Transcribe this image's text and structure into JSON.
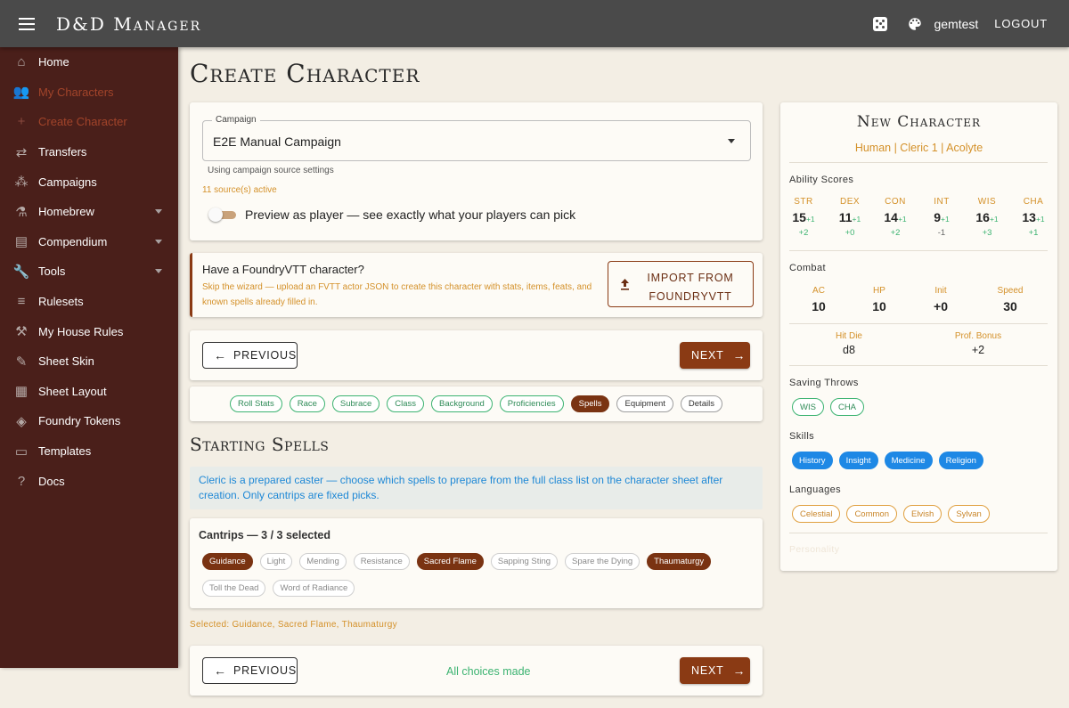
{
  "app": {
    "title": "D&D Manager",
    "username": "gemtest",
    "logout_label": "LOGOUT"
  },
  "sidebar": {
    "items": [
      {
        "label": "Home",
        "icon": "home-icon"
      },
      {
        "label": "My Characters",
        "icon": "people-icon"
      },
      {
        "label": "Create Character",
        "icon": "plus-icon"
      },
      {
        "label": "Transfers",
        "icon": "swap-icon"
      },
      {
        "label": "Campaigns",
        "icon": "groups-icon"
      },
      {
        "label": "Homebrew",
        "icon": "flask-icon"
      },
      {
        "label": "Compendium",
        "icon": "book-icon"
      },
      {
        "label": "Tools",
        "icon": "wrench-icon"
      },
      {
        "label": "Rulesets",
        "icon": "rules-icon"
      },
      {
        "label": "My House Rules",
        "icon": "gavel-icon"
      },
      {
        "label": "Sheet Skin",
        "icon": "brush-icon"
      },
      {
        "label": "Sheet Layout",
        "icon": "layout-icon"
      },
      {
        "label": "Foundry Tokens",
        "icon": "cube-icon"
      },
      {
        "label": "Templates",
        "icon": "document-icon"
      },
      {
        "label": "Docs",
        "icon": "help-icon"
      }
    ]
  },
  "page": {
    "title": "Create Character"
  },
  "campaign": {
    "label": "Campaign",
    "value": "E2E Manual Campaign",
    "help": "Using campaign source settings",
    "sources": "11 source(s) active",
    "toggle_label": "Preview as player — see exactly what your players can pick"
  },
  "foundry": {
    "title": "Have a FoundryVTT character?",
    "description": "Skip the wizard — upload an FVTT actor JSON to create this character with stats, items, feats, and known spells already filled in.",
    "import_label": "IMPORT FROM FOUNDRYVTT"
  },
  "nav": {
    "previous_label": "PREVIOUS",
    "next_label": "NEXT",
    "status": "All choices made"
  },
  "steps": {
    "done": [
      "Roll Stats",
      "Race",
      "Subrace",
      "Class",
      "Background",
      "Proficiencies"
    ],
    "active": "Spells",
    "todo": [
      "Equipment",
      "Details"
    ]
  },
  "spells": {
    "section_title": "Starting Spells",
    "info": "Cleric is a prepared caster — choose which spells to prepare from the full class list on the character sheet after creation. Only cantrips are fixed picks.",
    "cantrip_heading": "Cantrips — 3 / 3 selected",
    "row1": [
      {
        "name": "Guidance",
        "selected": true
      },
      {
        "name": "Light",
        "selected": false
      },
      {
        "name": "Mending",
        "selected": false
      },
      {
        "name": "Resistance",
        "selected": false
      },
      {
        "name": "Sacred Flame",
        "selected": true
      },
      {
        "name": "Sapping Sting",
        "selected": false
      },
      {
        "name": "Spare the Dying",
        "selected": false
      },
      {
        "name": "Thaumaturgy",
        "selected": true
      }
    ],
    "row2": [
      {
        "name": "Toll the Dead",
        "selected": false
      },
      {
        "name": "Word of Radiance",
        "selected": false
      }
    ],
    "selected_summary": "Selected: Guidance, Sacred Flame, Thaumaturgy"
  },
  "summary": {
    "name": "New Character",
    "subtitle": "Human | Cleric 1 | Acolyte",
    "ability_label": "Ability Scores",
    "abilities": [
      {
        "key": "STR",
        "score": "15",
        "bonus": "+1",
        "mod": "+2"
      },
      {
        "key": "DEX",
        "score": "11",
        "bonus": "+1",
        "mod": "+0"
      },
      {
        "key": "CON",
        "score": "14",
        "bonus": "+1",
        "mod": "+2"
      },
      {
        "key": "INT",
        "score": "9",
        "bonus": "+1",
        "mod": "-1"
      },
      {
        "key": "WIS",
        "score": "16",
        "bonus": "+1",
        "mod": "+3"
      },
      {
        "key": "CHA",
        "score": "13",
        "bonus": "+1",
        "mod": "+1"
      }
    ],
    "combat_label": "Combat",
    "combat": [
      {
        "key": "AC",
        "value": "10"
      },
      {
        "key": "HP",
        "value": "10"
      },
      {
        "key": "Init",
        "value": "+0"
      },
      {
        "key": "Speed",
        "value": "30"
      }
    ],
    "hit_die": {
      "key": "Hit Die",
      "value": "d8"
    },
    "prof_bonus": {
      "key": "Prof. Bonus",
      "value": "+2"
    },
    "saves_label": "Saving Throws",
    "saves": [
      "WIS",
      "CHA"
    ],
    "skills_label": "Skills",
    "skills": [
      "History",
      "Insight",
      "Medicine",
      "Religion"
    ],
    "languages_label": "Languages",
    "languages": [
      "Celestial",
      "Common",
      "Elvish",
      "Sylvan"
    ],
    "personality_label": "Personality"
  },
  "colors": {
    "brand": "#8a3a14",
    "sidebar": "#4a1f1a",
    "topbar": "#4a4a4a",
    "accent_orange": "#d4912a",
    "success_green": "#3cb371",
    "info_blue": "#1e88e5"
  }
}
